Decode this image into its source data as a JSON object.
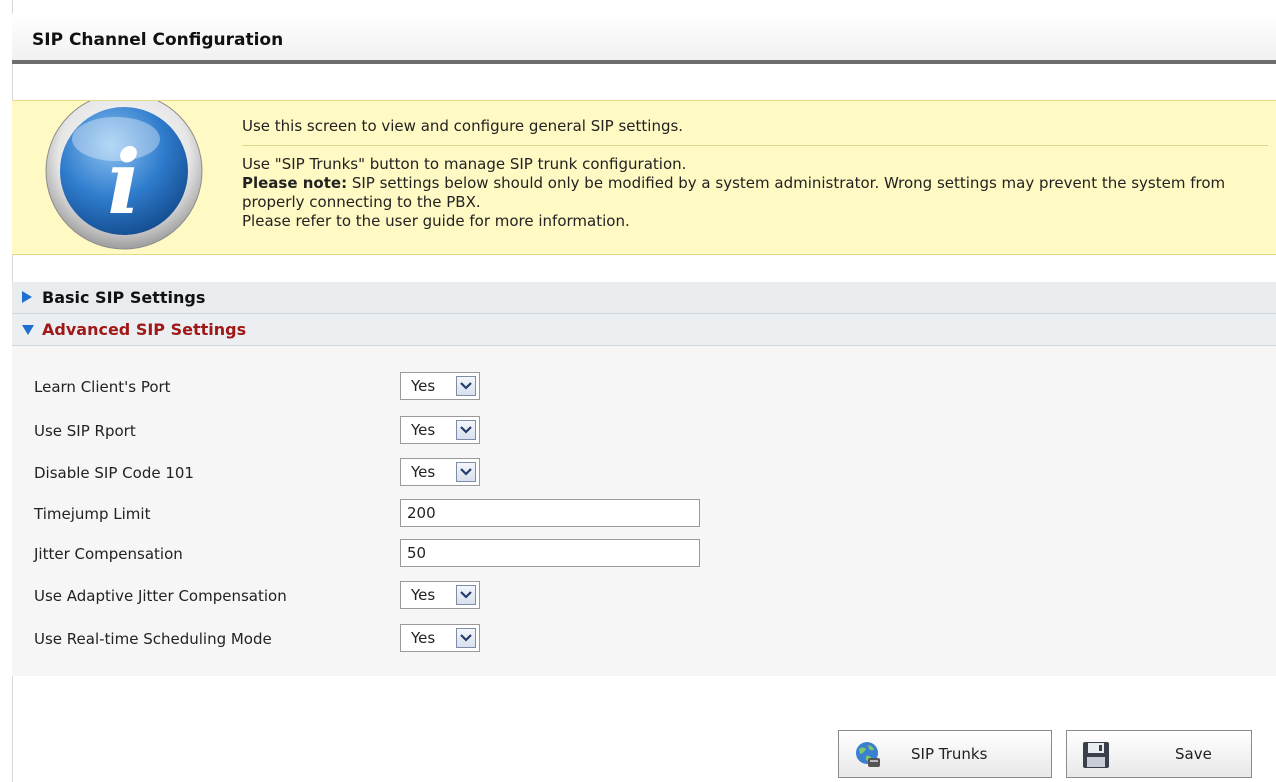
{
  "header": {
    "title": "SIP Channel Configuration"
  },
  "info": {
    "line1": "Use this screen to view and configure general SIP settings.",
    "line2": "Use \"SIP Trunks\" button to manage SIP trunk configuration.",
    "note_bold": "Please note:",
    "note_text": " SIP settings below should only be modified by a system administrator. Wrong settings may prevent the system from properly connecting to the PBX.",
    "line4": "Please refer to the user guide for more information.",
    "icon": "info-icon",
    "icon_letter": "i"
  },
  "sections": {
    "basic": {
      "label": "Basic SIP Settings",
      "expanded": false
    },
    "advanced": {
      "label": "Advanced SIP Settings",
      "expanded": true
    }
  },
  "settings": [
    {
      "label": "Learn Client's Port",
      "type": "select",
      "value": "Yes"
    },
    {
      "label": "Use SIP Rport",
      "type": "select",
      "value": "Yes"
    },
    {
      "label": "Disable SIP Code 101",
      "type": "select",
      "value": "Yes"
    },
    {
      "label": "Timejump Limit",
      "type": "text",
      "value": "200"
    },
    {
      "label": "Jitter Compensation",
      "type": "text",
      "value": "50"
    },
    {
      "label": "Use Adaptive Jitter Compensation",
      "type": "select",
      "value": "Yes"
    },
    {
      "label": "Use Real-time Scheduling Mode",
      "type": "select",
      "value": "Yes"
    }
  ],
  "buttons": {
    "sip_trunks": {
      "label": "SIP Trunks",
      "icon": "sip-trunks-icon"
    },
    "save": {
      "label": "Save",
      "icon": "floppy-disk-icon"
    }
  },
  "colors": {
    "info_bg": "#fff9c4",
    "advanced_heading": "#a01818",
    "section_bg": "#e9ecef"
  }
}
